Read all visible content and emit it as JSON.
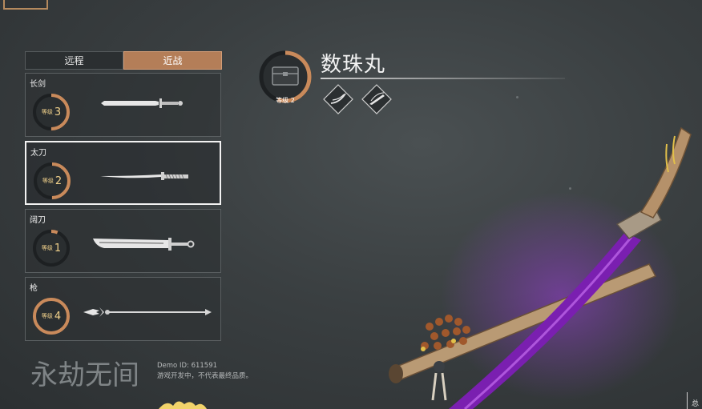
{
  "tabs": {
    "ranged": "远程",
    "melee": "近战",
    "active": "melee"
  },
  "weapons": [
    {
      "name": "长剑",
      "level_label": "等级",
      "level": "3",
      "progress": 0.5
    },
    {
      "name": "太刀",
      "level_label": "等级",
      "level": "2",
      "progress": 0.5
    },
    {
      "name": "阔刀",
      "level_label": "等级",
      "level": "1",
      "progress": 0.06
    },
    {
      "name": "枪",
      "level_label": "等级",
      "level": "4",
      "progress": 1.0
    }
  ],
  "selected_weapon": "太刀",
  "item": {
    "title": "数珠丸",
    "level_text": "等级 2",
    "progress": 0.55,
    "icon": "chest-icon"
  },
  "skills": [
    {
      "icon": "slash-skill-icon"
    },
    {
      "icon": "blade-skill-icon"
    }
  ],
  "watermark": {
    "logo_text": "永劫无间"
  },
  "demo": {
    "line1": "Demo    ID: 611591",
    "line2": "游戏开发中，不代表最终品质。"
  },
  "corner": {
    "right_text": "总"
  },
  "colors": {
    "accent": "#b47e58",
    "gold": "#f0d08a",
    "ring_bg": "#202426"
  }
}
